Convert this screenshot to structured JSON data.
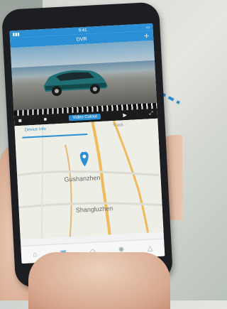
{
  "app": {
    "title": "DVR",
    "add_icon": "plus-icon"
  },
  "status": {
    "time": "9:41"
  },
  "video": {
    "cutout_label": "Video Cutout"
  },
  "map": {
    "tabs": [
      "Device Info",
      "Track"
    ],
    "places": [
      "Gushanzhen",
      "Shangluzhen"
    ]
  },
  "bottom_nav": [
    {
      "icon": "home-icon"
    },
    {
      "icon": "video-icon"
    },
    {
      "icon": "album-icon"
    },
    {
      "icon": "settings-icon"
    },
    {
      "icon": "profile-icon"
    }
  ],
  "colors": {
    "accent": "#2b8fd6",
    "pin": "#2b8fd6",
    "road": "#f0b95c"
  }
}
